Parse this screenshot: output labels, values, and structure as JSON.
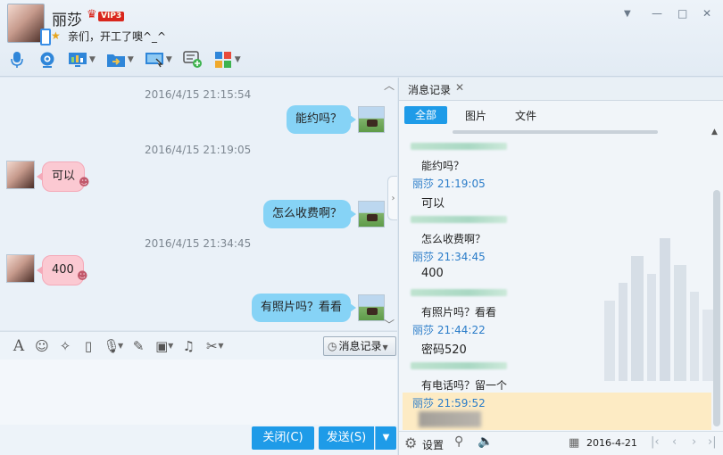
{
  "header": {
    "contact_name": "丽莎",
    "vip_label": "VIP3",
    "signature": "亲们，开工了噢^_^"
  },
  "window_controls": [
    "▼",
    "—",
    "□",
    "✕"
  ],
  "toolbar_icons": [
    "microphone-icon",
    "camera-icon",
    "screen-share-icon",
    "file-transfer-icon",
    "remote-assist-icon",
    "new-chat-icon",
    "apps-icon"
  ],
  "chat": {
    "messages": [
      {
        "timestamp": "2016/4/15 21:15:54",
        "side": "right",
        "text": "能约吗？"
      },
      {
        "timestamp": "2016/4/15 21:19:05",
        "side": "left",
        "text": "可以"
      },
      {
        "timestamp": "",
        "side": "right",
        "text": "怎么收费啊？"
      },
      {
        "timestamp": "2016/4/15 21:34:45",
        "side": "left",
        "text": "400"
      },
      {
        "timestamp": "",
        "side": "right",
        "text": "有照片吗？看看"
      }
    ]
  },
  "input_toolbar": {
    "history_button": "消息记录"
  },
  "buttons": {
    "close": "关闭(C)",
    "send": "发送(S)"
  },
  "history_panel": {
    "tab_label": "消息记录",
    "filters": {
      "all": "全部",
      "images": "图片",
      "files": "文件"
    },
    "entries": [
      {
        "sender": "",
        "time": "",
        "text": "能约吗？"
      },
      {
        "sender": "丽莎",
        "time": "21:19:05",
        "text": "可以"
      },
      {
        "sender": "",
        "time": "",
        "text": "怎么收费啊？"
      },
      {
        "sender": "丽莎",
        "time": "21:34:45",
        "text": "400"
      },
      {
        "sender": "",
        "time": "",
        "text": "有照片吗？看看"
      },
      {
        "sender": "丽莎",
        "time": "21:44:22",
        "text": "密码520"
      },
      {
        "sender": "",
        "time": "",
        "text": "有电话吗？留一个"
      },
      {
        "sender": "丽莎",
        "time": "21:59:52",
        "text": ""
      }
    ],
    "bottom": {
      "settings_label": "设置",
      "date": "2016-4-21"
    }
  },
  "colors": {
    "accent_blue": "#1e9be8",
    "my_bubble": "#86d3f6",
    "their_bubble": "#fbc9d2",
    "highlight_row": "#fdebc4",
    "sender_blue": "#2a7cc9"
  }
}
